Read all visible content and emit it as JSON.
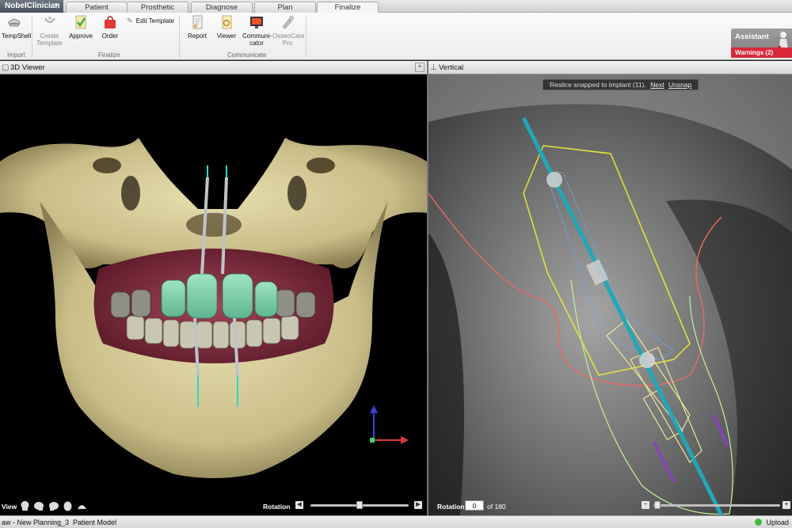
{
  "app": {
    "menu_label": "NobelClinician"
  },
  "tabs": [
    {
      "label": "Patient"
    },
    {
      "label": "Prosthetic"
    },
    {
      "label": "Diagnose"
    },
    {
      "label": "Plan"
    },
    {
      "label": "Finalize",
      "active": true
    }
  ],
  "ribbon": {
    "import": {
      "group_label": "Import",
      "tempshell": "TempShell"
    },
    "finalize": {
      "group_label": "Finalize",
      "create_template": "Create Template",
      "approve": "Approve",
      "order": "Order",
      "edit_template": "Edit Template"
    },
    "communicate": {
      "group_label": "Communicate",
      "report": "Report",
      "viewer": "Viewer",
      "communicator": "Communi-cator",
      "osseocare": "OsseoCare Pro"
    }
  },
  "assistant": {
    "title": "Assistant",
    "warnings": "Warnings (2)",
    "warning_color": "#d8283a"
  },
  "viewer3d": {
    "title": "3D Viewer",
    "view_label": "View",
    "rotation_label": "Rotation",
    "rotation_slider_fraction": 0.5
  },
  "vertical": {
    "title": "Vertical",
    "reslice_text": "Reslice snapped to Implant (11).",
    "reslice_next": "Next",
    "reslice_unsnap": "Unsnap",
    "rotation_label": "Rotation",
    "rotation_value": "0",
    "rotation_of": "of 180",
    "zoom_slider_fraction": 0.02
  },
  "status": {
    "document": "aw - New Planning_3",
    "model": "Patient Model",
    "upload": "Upload"
  },
  "colors": {
    "implant_axis": "#1fa8b8",
    "bone_outline": "#e86a6a",
    "template_outline": "#e6e63a",
    "thread_outline": "#6aa8e6",
    "sleeve_outline": "#e8e89a",
    "guide_outline": "#c2f0a0",
    "pin_color": "#8a3ec8"
  }
}
